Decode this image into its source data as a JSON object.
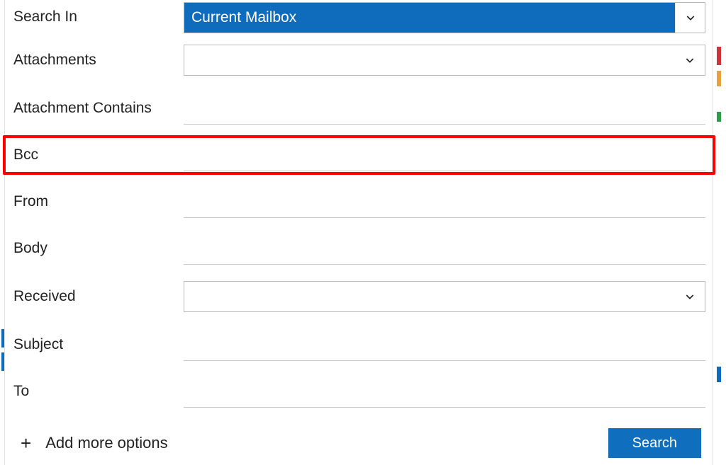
{
  "fields": {
    "search_in": {
      "label": "Search In",
      "value": "Current Mailbox"
    },
    "attachments": {
      "label": "Attachments",
      "value": ""
    },
    "attachment_contains": {
      "label": "Attachment Contains",
      "value": ""
    },
    "bcc": {
      "label": "Bcc",
      "value": ""
    },
    "from": {
      "label": "From",
      "value": ""
    },
    "body": {
      "label": "Body",
      "value": ""
    },
    "received": {
      "label": "Received",
      "value": ""
    },
    "subject": {
      "label": "Subject",
      "value": ""
    },
    "to": {
      "label": "To",
      "value": ""
    }
  },
  "footer": {
    "add_more": "Add more options",
    "search": "Search"
  },
  "colors": {
    "primary": "#106ebe",
    "highlight": "#ff0000"
  }
}
